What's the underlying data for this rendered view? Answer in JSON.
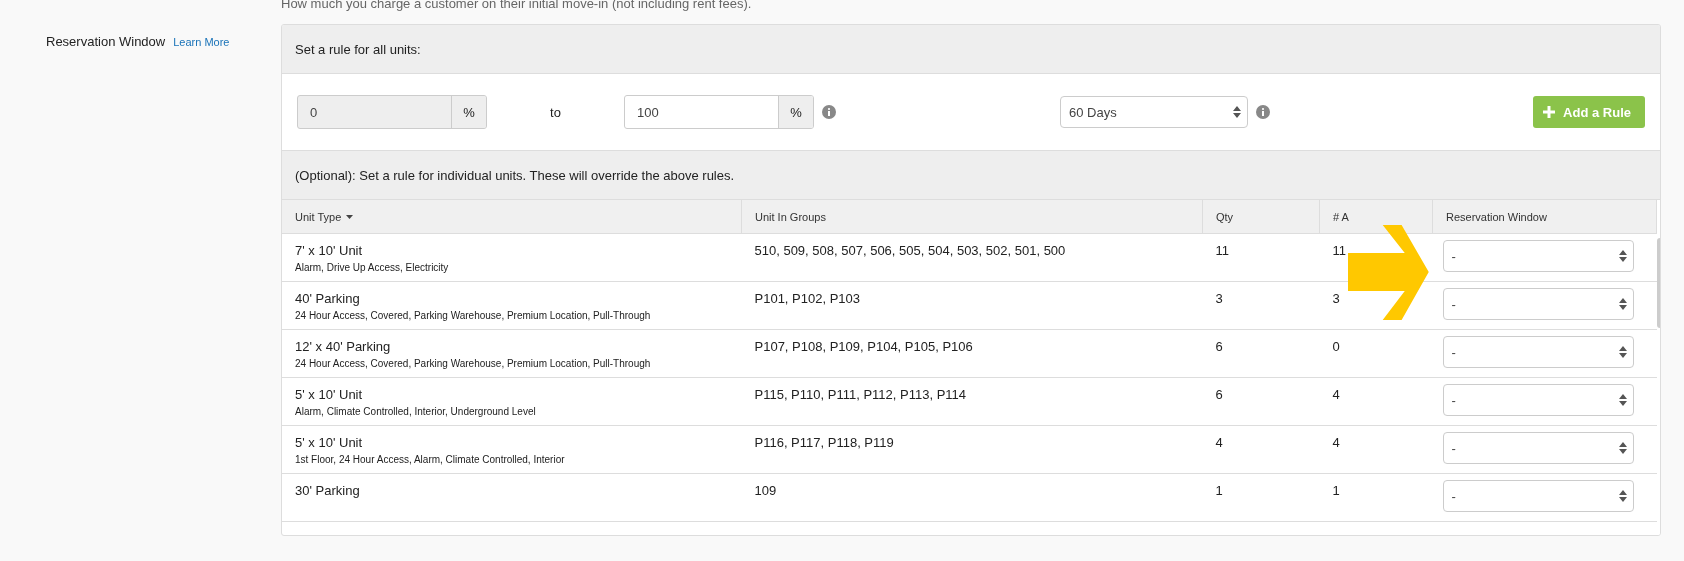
{
  "intro_text": "How much you charge a customer on their initial move-in (not including rent fees).",
  "field": {
    "label": "Reservation Window",
    "link": "Learn More"
  },
  "all_units": {
    "heading": "Set a rule for all units:",
    "min": {
      "value": "0",
      "unit": "%",
      "disabled": true
    },
    "separator": "to",
    "max": {
      "value": "100",
      "unit": "%",
      "disabled": false
    },
    "period": {
      "value": "60 Days"
    },
    "add_button": "Add a Rule"
  },
  "individual": {
    "heading": "(Optional): Set a rule for individual units. These will override the above rules."
  },
  "table": {
    "columns": [
      {
        "label": "Unit Type",
        "sorted": true
      },
      {
        "label": "Unit In Groups",
        "sorted": false
      },
      {
        "label": "Qty",
        "sorted": false
      },
      {
        "label": "# A",
        "sorted": false
      },
      {
        "label": "Reservation Window",
        "sorted": false
      }
    ],
    "rows": [
      {
        "unit_type": "7' x 10' Unit",
        "features": "Alarm, Drive Up Access, Electricity",
        "groups": "510, 509, 508, 507, 506, 505, 504, 503, 502, 501, 500",
        "qty": "11",
        "available": "11",
        "window": "-"
      },
      {
        "unit_type": "40' Parking",
        "features": "24 Hour Access, Covered, Parking Warehouse, Premium Location, Pull-Through",
        "groups": "P101, P102, P103",
        "qty": "3",
        "available": "3",
        "window": "-"
      },
      {
        "unit_type": "12' x 40' Parking",
        "features": "24 Hour Access, Covered, Parking Warehouse, Premium Location, Pull-Through",
        "groups": "P107, P108, P109, P104, P105, P106",
        "qty": "6",
        "available": "0",
        "window": "-"
      },
      {
        "unit_type": "5' x 10' Unit",
        "features": "Alarm, Climate Controlled, Interior, Underground Level",
        "groups": "P115, P110, P111, P112, P113, P114",
        "qty": "6",
        "available": "4",
        "window": "-"
      },
      {
        "unit_type": "5' x 10' Unit",
        "features": "1st Floor, 24 Hour Access, Alarm, Climate Controlled, Interior",
        "groups": "P116, P117, P118, P119",
        "qty": "4",
        "available": "4",
        "window": "-"
      },
      {
        "unit_type": "30' Parking",
        "groups": "109",
        "qty": "1",
        "available": "1",
        "window": "-"
      }
    ]
  }
}
